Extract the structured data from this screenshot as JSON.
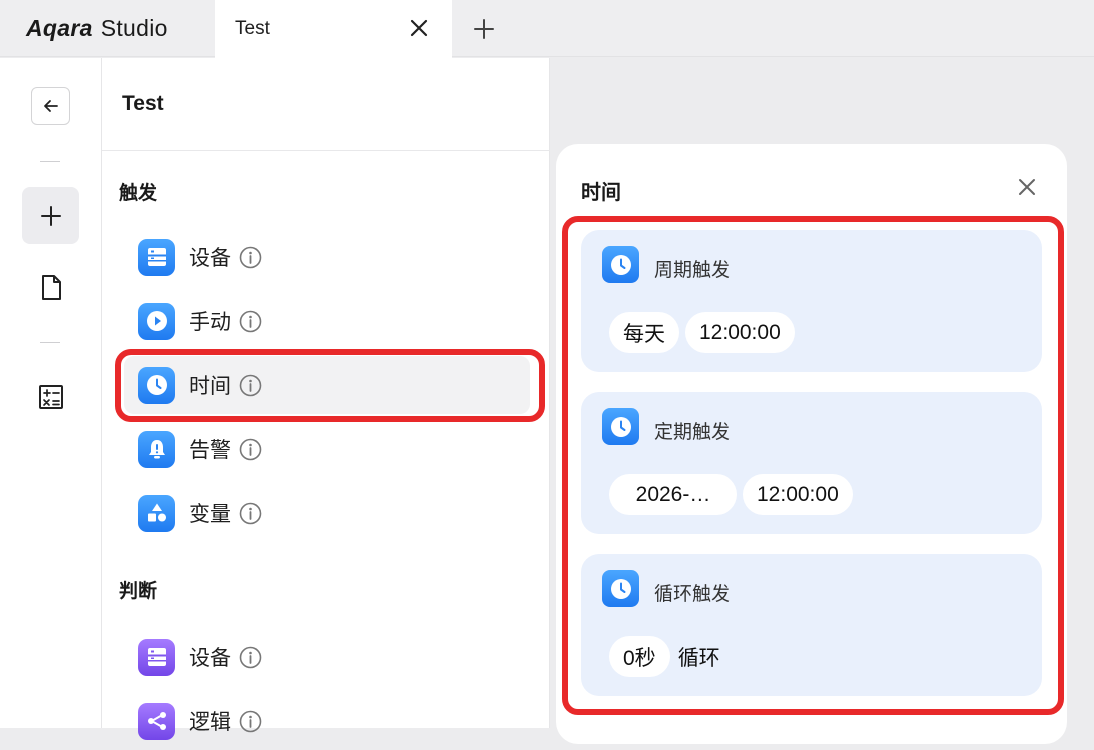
{
  "app": {
    "brand_logo": "Aqara",
    "brand_name": "Studio"
  },
  "tabs": [
    {
      "label": "Test"
    }
  ],
  "panel": {
    "title": "Test",
    "sections": [
      {
        "label": "触发",
        "items": [
          {
            "label": "设备",
            "icon": "device-icon",
            "color": "blue"
          },
          {
            "label": "手动",
            "icon": "play-icon",
            "color": "blue"
          },
          {
            "label": "时间",
            "icon": "clock-icon",
            "color": "blue",
            "selected": true
          },
          {
            "label": "告警",
            "icon": "alarm-icon",
            "color": "blue"
          },
          {
            "label": "变量",
            "icon": "shapes-icon",
            "color": "blue"
          }
        ]
      },
      {
        "label": "判断",
        "items": [
          {
            "label": "设备",
            "icon": "device-icon",
            "color": "purple"
          },
          {
            "label": "逻辑",
            "icon": "logic-icon",
            "color": "purple"
          }
        ]
      }
    ]
  },
  "detail": {
    "title": "时间",
    "triggers": [
      {
        "name": "周期触发",
        "chips": [
          "每天",
          "12:00:00"
        ],
        "suffix": ""
      },
      {
        "name": "定期触发",
        "chips": [
          "2026-…",
          "12:00:00"
        ],
        "suffix": ""
      },
      {
        "name": "循环触发",
        "chips": [
          "0秒"
        ],
        "suffix": "循环"
      }
    ]
  },
  "colors": {
    "accent_blue": "#1f7af0",
    "accent_purple": "#7346e8",
    "highlight": "#e8292a"
  }
}
